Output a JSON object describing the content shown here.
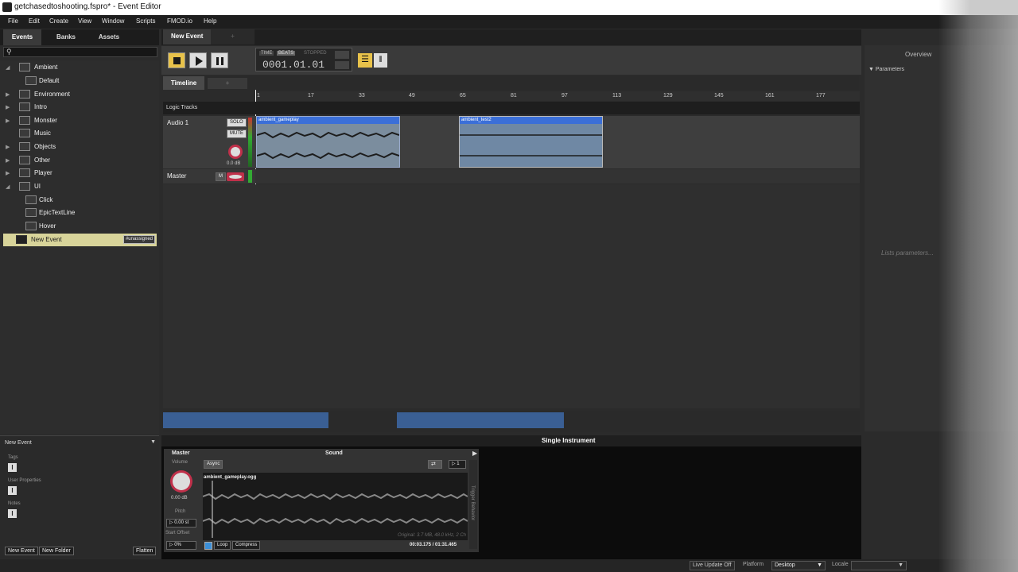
{
  "window": {
    "title": "getchasedtoshooting.fspro* - Event Editor"
  },
  "menu": [
    "File",
    "Edit",
    "Create",
    "View",
    "Window",
    "Scripts",
    "FMOD.io",
    "Help"
  ],
  "left_tabs": [
    "Events",
    "Banks",
    "Assets"
  ],
  "tree": [
    {
      "label": "Ambient",
      "expanded": true,
      "level": 0
    },
    {
      "label": "Default",
      "level": 1
    },
    {
      "label": "Environment",
      "level": 0
    },
    {
      "label": "Intro",
      "level": 0
    },
    {
      "label": "Monster",
      "level": 0
    },
    {
      "label": "Music",
      "level": 0
    },
    {
      "label": "Objects",
      "level": 0
    },
    {
      "label": "Other",
      "level": 0
    },
    {
      "label": "Player",
      "level": 0
    },
    {
      "label": "UI",
      "expanded": true,
      "level": 0
    },
    {
      "label": "Click",
      "level": 1
    },
    {
      "label": "EpicTextLine",
      "level": 1
    },
    {
      "label": "Hover",
      "level": 1
    }
  ],
  "selected_event": {
    "label": "New Event",
    "badge": "#unassigned"
  },
  "props": {
    "header": "New Event",
    "tags": "Tags",
    "user_properties": "User Properties",
    "notes": "Notes",
    "new_event": "New Event",
    "new_folder": "New Folder",
    "flatten": "Flatten"
  },
  "event_tab": {
    "label": "New Event",
    "add": "+"
  },
  "transport": {
    "time": "TIME",
    "beats": "BEATS",
    "state": "STOPPED",
    "position": "0001.01.01"
  },
  "timeline": {
    "tab": "Timeline",
    "add": "+",
    "logic_tracks": "Logic Tracks",
    "ruler": [
      "1",
      "17",
      "33",
      "49",
      "65",
      "81",
      "97",
      "113",
      "129",
      "145",
      "161",
      "177"
    ]
  },
  "track": {
    "name": "Audio 1",
    "solo": "SOLO",
    "mute": "MUTE",
    "level": "0.0 dB"
  },
  "master_track": {
    "name": "Master",
    "m": "M"
  },
  "regions": [
    {
      "name": "ambient_gameplay"
    },
    {
      "name": "ambient_test2"
    }
  ],
  "right_panel": {
    "overview": "Overview",
    "parameters": "Parameters",
    "hint": "Lists parameters..."
  },
  "bottom": {
    "title": "Single Instrument",
    "master": "Master",
    "sound": "Sound",
    "volume": "Volume",
    "volume_value": "0.00 dB",
    "pitch": "Pitch",
    "pitch_value": "0.00 st",
    "start_offset": "Start Offset",
    "start_offset_value": "0%",
    "async": "Async",
    "loop_count": "1",
    "file": "ambient_gameplay.ogg",
    "info": "Original: 3.7 MB, 48.0 kHz, 2 Ch",
    "time": "00:03.175 / 01:31.465",
    "loop": "Loop",
    "compress": "Compress",
    "trigger": "Trigger Behavior"
  },
  "status": {
    "live_update": "Live Update Off",
    "platform_label": "Platform",
    "platform": "Desktop",
    "locale": "Locale"
  }
}
